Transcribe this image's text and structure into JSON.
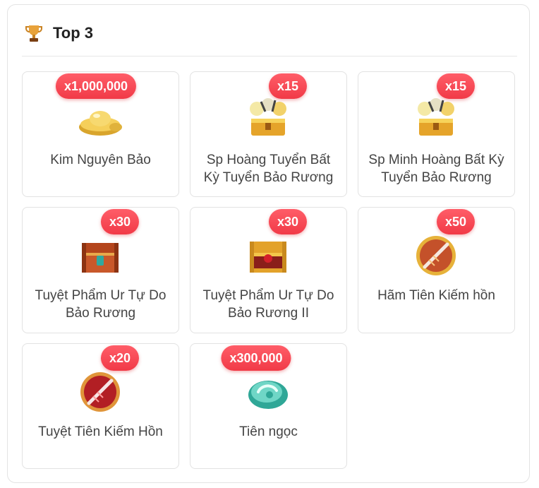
{
  "header": {
    "title": "Top 3",
    "icon": "trophy-icon"
  },
  "colors": {
    "badge": "#f13a47",
    "border": "#e2e2e2",
    "text": "#444444"
  },
  "rewards": [
    {
      "name": "Kim Nguyên Bảo",
      "qty": "x1,000,000",
      "icon": "gold-ingot-icon"
    },
    {
      "name": "Sp Hoàng Tuyển Bất Kỳ Tuyển Bảo Rương",
      "qty": "x15",
      "icon": "treasure-chest-icon"
    },
    {
      "name": "Sp Minh Hoàng Bất Kỳ Tuyển Bảo Rương",
      "qty": "x15",
      "icon": "treasure-chest-icon"
    },
    {
      "name": "Tuyệt Phẩm Ur Tự Do Bảo Rương",
      "qty": "x30",
      "icon": "ornate-chest-icon"
    },
    {
      "name": "Tuyệt Phẩm Ur Tự Do Bảo Rương II",
      "qty": "x30",
      "icon": "golden-chest-icon"
    },
    {
      "name": "Hãm Tiên Kiếm hồn",
      "qty": "x50",
      "icon": "sword-soul-orb-icon"
    },
    {
      "name": "Tuyệt Tiên Kiếm Hồn",
      "qty": "x20",
      "icon": "sword-soul-orb-red-icon"
    },
    {
      "name": "Tiên ngọc",
      "qty": "x300,000",
      "icon": "jade-icon"
    }
  ]
}
